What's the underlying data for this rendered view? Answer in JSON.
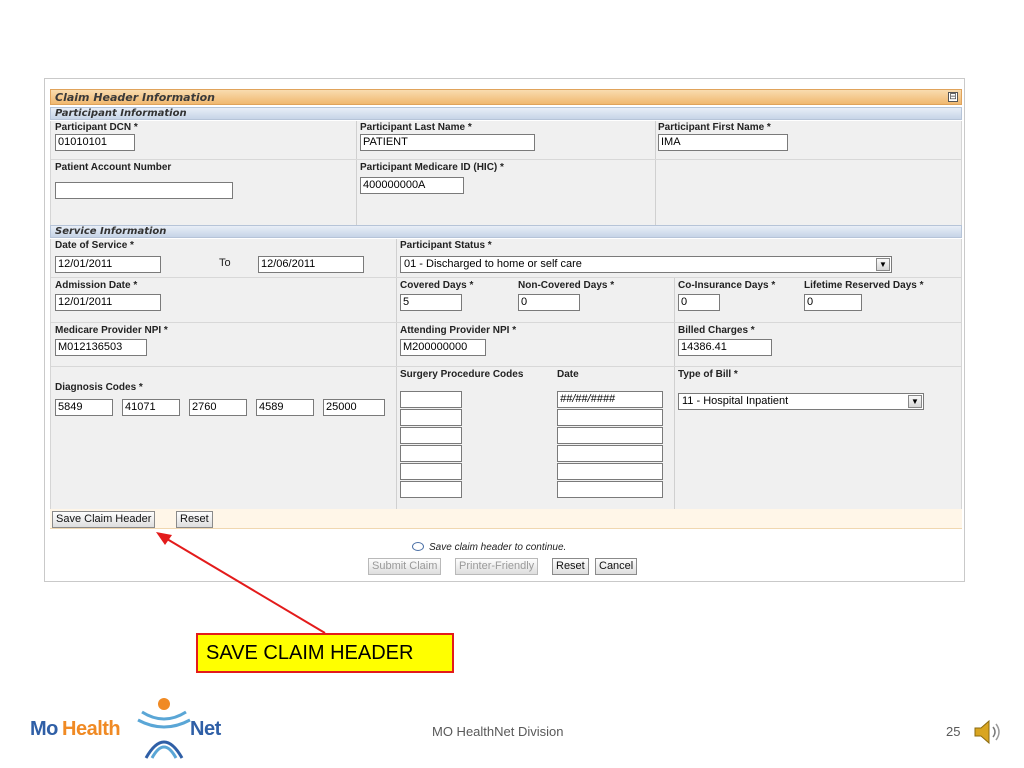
{
  "form": {
    "title": "Claim Header Information",
    "collapse_glyph": "⊟",
    "participant_section": {
      "title": "Participant Information",
      "dcn_label": "Participant DCN *",
      "dcn_value": "01010101",
      "last_name_label": "Participant Last Name *",
      "last_name_value": "PATIENT",
      "first_name_label": "Participant First Name *",
      "first_name_value": "IMA",
      "account_label": "Patient Account Number",
      "account_value": "",
      "medicare_id_label": "Participant Medicare ID (HIC) *",
      "medicare_id_value": "400000000A"
    },
    "service_section": {
      "title": "Service Information",
      "dos_label": "Date of Service *",
      "dos_from": "12/01/2011",
      "to_label": "To",
      "dos_to": "12/06/2011",
      "status_label": "Participant Status *",
      "status_value": "01 - Discharged to home or self care",
      "admission_label": "Admission Date *",
      "admission_value": "12/01/2011",
      "covered_label": "Covered Days *",
      "covered_value": "5",
      "noncovered_label": "Non-Covered Days *",
      "noncovered_value": "0",
      "coins_label": "Co-Insurance Days *",
      "coins_value": "0",
      "lifetime_label": "Lifetime Reserved Days *",
      "lifetime_value": "0",
      "npi_label": "Medicare Provider NPI *",
      "npi_value": "M012136503",
      "attending_label": "Attending Provider NPI *",
      "attending_value": "M200000000",
      "billed_label": "Billed Charges *",
      "billed_value": "14386.41",
      "diag_label": "Diagnosis Codes *",
      "diag_codes": [
        "5849",
        "41071",
        "2760",
        "4589",
        "25000"
      ],
      "surgery_label": "Surgery Procedure Codes",
      "date_label": "Date",
      "date_first_value": "##/##/####",
      "bill_type_label": "Type of Bill *",
      "bill_type_value": "11 - Hospital Inpatient"
    },
    "buttons": {
      "save_header": "Save Claim Header",
      "reset": "Reset",
      "submit": "Submit Claim",
      "printer": "Printer-Friendly",
      "reset2": "Reset",
      "cancel": "Cancel"
    },
    "hint": "Save claim header to continue."
  },
  "callout_text": "SAVE CLAIM HEADER",
  "footer": {
    "center": "MO HealthNet Division",
    "page": "25",
    "logo": {
      "mo": "Mo",
      "health": "Health",
      "net": "Net"
    }
  },
  "colors": {
    "accent_orange": "#f0b870",
    "section_blue": "#c6d4e7",
    "arrow_red": "#e31b1b",
    "callout_yellow": "#ffff00"
  }
}
